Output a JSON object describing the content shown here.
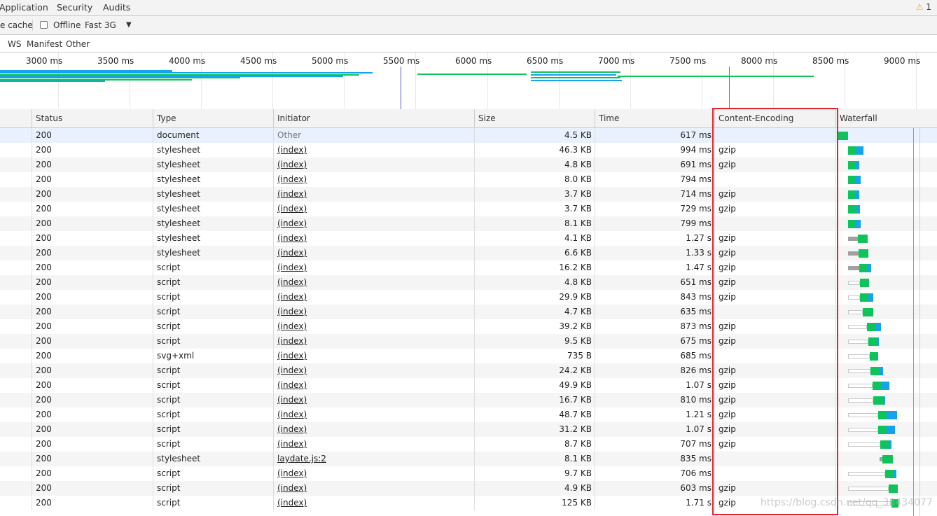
{
  "tabs": [
    "Application",
    "Security",
    "Audits"
  ],
  "warning_count": "1",
  "toolbar": {
    "cache_label": "e cache",
    "offline_label": "Offline",
    "throttle": "Fast 3G"
  },
  "filters": [
    "WS",
    "Manifest",
    "Other"
  ],
  "timeline_ticks": [
    "3000 ms",
    "3500 ms",
    "4000 ms",
    "4500 ms",
    "5000 ms",
    "5500 ms",
    "6000 ms",
    "6500 ms",
    "7000 ms",
    "7500 ms",
    "8000 ms",
    "8500 ms",
    "9000 ms"
  ],
  "columns": [
    "Status",
    "Type",
    "Initiator",
    "Size",
    "Time",
    "Content-Encoding",
    "Waterfall"
  ],
  "rows": [
    {
      "status": "200",
      "type": "document",
      "initiator": "Other",
      "size": "4.5 KB",
      "time": "617 ms",
      "encoding": ""
    },
    {
      "status": "200",
      "type": "stylesheet",
      "initiator": "(index)",
      "size": "46.3 KB",
      "time": "994 ms",
      "encoding": "gzip"
    },
    {
      "status": "200",
      "type": "stylesheet",
      "initiator": "(index)",
      "size": "4.8 KB",
      "time": "691 ms",
      "encoding": "gzip"
    },
    {
      "status": "200",
      "type": "stylesheet",
      "initiator": "(index)",
      "size": "8.0 KB",
      "time": "794 ms",
      "encoding": ""
    },
    {
      "status": "200",
      "type": "stylesheet",
      "initiator": "(index)",
      "size": "3.7 KB",
      "time": "714 ms",
      "encoding": "gzip"
    },
    {
      "status": "200",
      "type": "stylesheet",
      "initiator": "(index)",
      "size": "3.7 KB",
      "time": "729 ms",
      "encoding": "gzip"
    },
    {
      "status": "200",
      "type": "stylesheet",
      "initiator": "(index)",
      "size": "8.1 KB",
      "time": "799 ms",
      "encoding": ""
    },
    {
      "status": "200",
      "type": "stylesheet",
      "initiator": "(index)",
      "size": "4.1 KB",
      "time": "1.27 s",
      "encoding": "gzip"
    },
    {
      "status": "200",
      "type": "stylesheet",
      "initiator": "(index)",
      "size": "6.6 KB",
      "time": "1.33 s",
      "encoding": "gzip"
    },
    {
      "status": "200",
      "type": "script",
      "initiator": "(index)",
      "size": "16.2 KB",
      "time": "1.47 s",
      "encoding": "gzip"
    },
    {
      "status": "200",
      "type": "script",
      "initiator": "(index)",
      "size": "4.8 KB",
      "time": "651 ms",
      "encoding": "gzip"
    },
    {
      "status": "200",
      "type": "script",
      "initiator": "(index)",
      "size": "29.9 KB",
      "time": "843 ms",
      "encoding": "gzip"
    },
    {
      "status": "200",
      "type": "script",
      "initiator": "(index)",
      "size": "4.7 KB",
      "time": "635 ms",
      "encoding": ""
    },
    {
      "status": "200",
      "type": "script",
      "initiator": "(index)",
      "size": "39.2 KB",
      "time": "873 ms",
      "encoding": "gzip"
    },
    {
      "status": "200",
      "type": "script",
      "initiator": "(index)",
      "size": "9.5 KB",
      "time": "675 ms",
      "encoding": "gzip"
    },
    {
      "status": "200",
      "type": "svg+xml",
      "initiator": "(index)",
      "size": "735 B",
      "time": "685 ms",
      "encoding": ""
    },
    {
      "status": "200",
      "type": "script",
      "initiator": "(index)",
      "size": "24.2 KB",
      "time": "826 ms",
      "encoding": "gzip"
    },
    {
      "status": "200",
      "type": "script",
      "initiator": "(index)",
      "size": "49.9 KB",
      "time": "1.07 s",
      "encoding": "gzip"
    },
    {
      "status": "200",
      "type": "script",
      "initiator": "(index)",
      "size": "16.7 KB",
      "time": "810 ms",
      "encoding": "gzip"
    },
    {
      "status": "200",
      "type": "script",
      "initiator": "(index)",
      "size": "48.7 KB",
      "time": "1.21 s",
      "encoding": "gzip"
    },
    {
      "status": "200",
      "type": "script",
      "initiator": "(index)",
      "size": "31.2 KB",
      "time": "1.07 s",
      "encoding": "gzip"
    },
    {
      "status": "200",
      "type": "script",
      "initiator": "(index)",
      "size": "8.7 KB",
      "time": "707 ms",
      "encoding": "gzip"
    },
    {
      "status": "200",
      "type": "stylesheet",
      "initiator": "laydate.js:2",
      "size": "8.1 KB",
      "time": "835 ms",
      "encoding": ""
    },
    {
      "status": "200",
      "type": "script",
      "initiator": "(index)",
      "size": "9.7 KB",
      "time": "706 ms",
      "encoding": ""
    },
    {
      "status": "200",
      "type": "script",
      "initiator": "(index)",
      "size": "4.9 KB",
      "time": "603 ms",
      "encoding": "gzip"
    },
    {
      "status": "200",
      "type": "script",
      "initiator": "(index)",
      "size": "125 KB",
      "time": "1.71 s",
      "encoding": "gzip"
    }
  ],
  "watermark": "https://blog.csdn.net/qq_38434077",
  "colors": {
    "accent_highlight": "#e0262d",
    "wf_green": "#0ec45a",
    "wf_blue": "#14a3f0",
    "wf_gray": "#a0a0a0"
  }
}
